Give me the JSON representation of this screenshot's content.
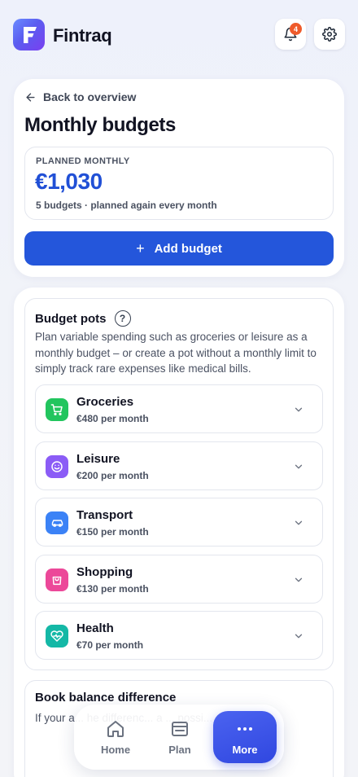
{
  "app": {
    "name": "Fintraq",
    "logo_letter": "F"
  },
  "header": {
    "notification_count": "4"
  },
  "back_link": "Back to overview",
  "page_title": "Monthly budgets",
  "planned": {
    "label": "PLANNED MONTHLY",
    "amount": "€1,030",
    "note": "5 budgets · planned again every month"
  },
  "add_button": {
    "plus": "+",
    "label": "Add budget"
  },
  "pots": {
    "title": "Budget pots",
    "help": "?",
    "description": "Plan variable spending such as groceries or leisure as a monthly budget – or create a pot without a monthly limit to simply track rare expenses like medical bills.",
    "items": [
      {
        "name": "Groceries",
        "amount": "€480 per month",
        "icon": "shopping-cart-icon",
        "color": "#22c55e"
      },
      {
        "name": "Leisure",
        "amount": "€200 per month",
        "icon": "smiley-icon",
        "color": "#8b5cf6"
      },
      {
        "name": "Transport",
        "amount": "€150 per month",
        "icon": "car-icon",
        "color": "#3b82f6"
      },
      {
        "name": "Shopping",
        "amount": "€130 per month",
        "icon": "shopping-bag-icon",
        "color": "#ec4899"
      },
      {
        "name": "Health",
        "amount": "€70 per month",
        "icon": "heart-pulse-icon",
        "color": "#14b8a6"
      }
    ]
  },
  "balance": {
    "title": "Book balance difference",
    "description": "If your a... he differenc... a ... possi..."
  },
  "nav": {
    "home": "Home",
    "plan": "Plan",
    "more": "More"
  }
}
